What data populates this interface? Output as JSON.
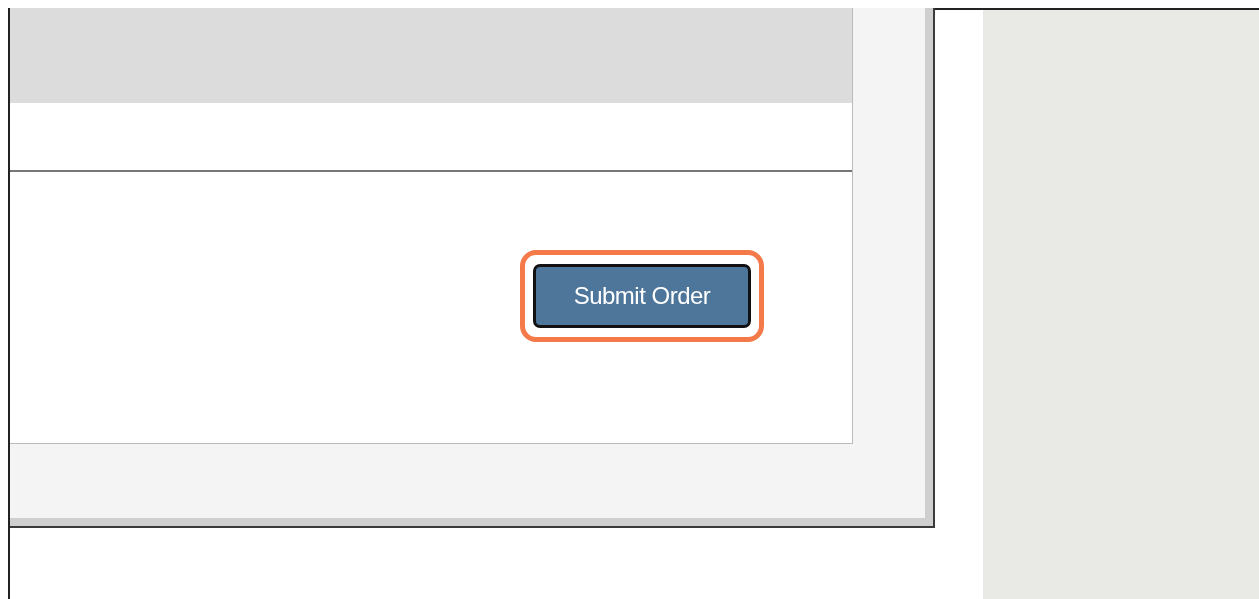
{
  "submit_button": {
    "label": "Submit Order",
    "highlighted": true
  }
}
